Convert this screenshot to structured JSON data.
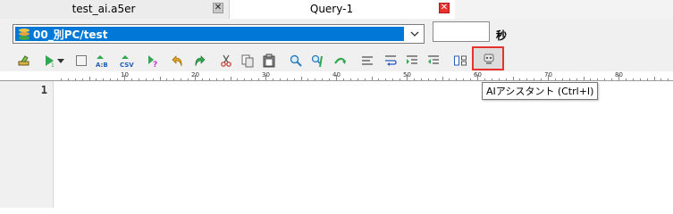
{
  "tabs": [
    {
      "label": "test_ai.a5er",
      "close_label": "✕",
      "active": false
    },
    {
      "label": "Query-1",
      "close_label": "✕",
      "active": true
    }
  ],
  "connection": {
    "selected": "00_別PC/test",
    "timeout_value": "",
    "timeout_unit": "秒"
  },
  "toolbar_icons": [
    "eraser-icon",
    "run-icon",
    "dropdown-arrow-icon",
    "stop-icon",
    "ab-compare-icon",
    "csv-export-icon",
    "query-help-icon",
    "undo-icon",
    "redo-icon",
    "cut-icon",
    "copy-icon",
    "paste-icon",
    "find-icon",
    "find-replace-icon",
    "wrap-icon",
    "align-icon",
    "line-wrap-icon",
    "indent-icon",
    "outdent-icon",
    "layout-icon",
    "ai-assistant-icon"
  ],
  "ruler": {
    "labels": [
      "10",
      "20",
      "30",
      "40",
      "50",
      "60",
      "70",
      "80"
    ]
  },
  "editor": {
    "line_numbers": [
      "1"
    ]
  },
  "tooltip": {
    "text": "AIアシスタント (Ctrl+I)"
  },
  "colors": {
    "selection": "#0078d7",
    "highlight_border": "#e8322f",
    "active_close": "#e8322f"
  }
}
